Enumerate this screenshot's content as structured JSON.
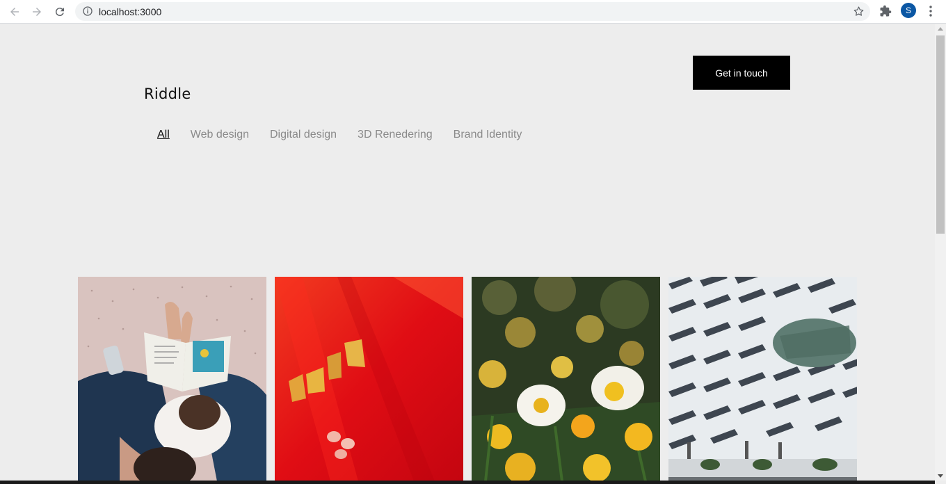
{
  "browser": {
    "url": "localhost:3000",
    "profile_initial": "S",
    "icons": {
      "back": "arrow-left-icon",
      "forward": "arrow-right-icon",
      "reload": "reload-icon",
      "info": "info-icon",
      "bookmark": "star-icon",
      "extensions": "puzzle-icon",
      "menu": "kebab-menu-icon"
    }
  },
  "page": {
    "logo": "Riddle",
    "cta_label": "Get in touch",
    "filters": [
      {
        "label": "All",
        "active": true
      },
      {
        "label": "Web design",
        "active": false
      },
      {
        "label": "Digital design",
        "active": false
      },
      {
        "label": "3D Renedering",
        "active": false
      },
      {
        "label": "Brand Identity",
        "active": false
      }
    ],
    "gallery": [
      {
        "image": "parent-reading-book-with-child"
      },
      {
        "image": "red-flower-petal-closeup"
      },
      {
        "image": "yellow-white-daffodils"
      },
      {
        "image": "white-building-facade-with-people"
      }
    ]
  },
  "colors": {
    "background": "#ededed",
    "cta_background": "#000000",
    "cta_text": "#ffffff",
    "filter_inactive": "#8a8a8a",
    "filter_active": "#111111"
  }
}
